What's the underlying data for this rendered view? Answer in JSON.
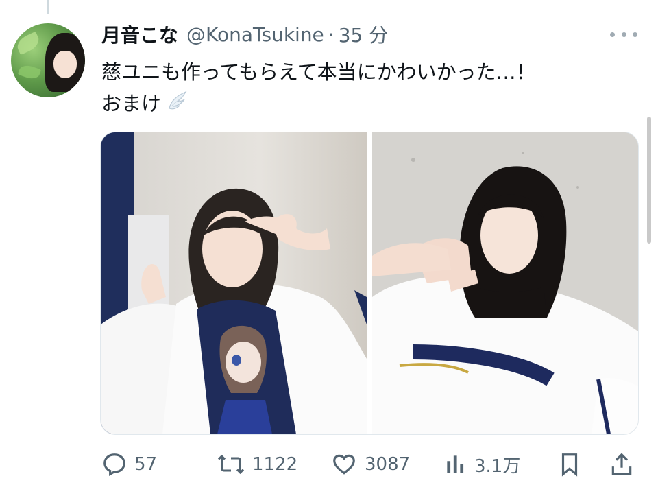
{
  "tweet": {
    "display_name": "月音こな",
    "handle": "@KonaTsukine",
    "separator": "·",
    "time": "35 分",
    "text_line1": "慈ユニも作ってもらえて本当にかわいかった…！",
    "text_line2": "おまけ",
    "emoji": "wing-emoji"
  },
  "media": {
    "count": 2
  },
  "actions": {
    "reply_count": "57",
    "retweet_count": "1122",
    "like_count": "3087",
    "views_count": "3.1万"
  },
  "icons": {
    "reply": "reply-icon",
    "retweet": "retweet-icon",
    "like": "heart-icon",
    "views": "views-icon",
    "bookmark": "bookmark-icon",
    "share": "share-icon",
    "more": "more-icon"
  },
  "colors": {
    "text": "#0f1419",
    "secondary": "#536471",
    "thread_line": "#cfd9de"
  }
}
